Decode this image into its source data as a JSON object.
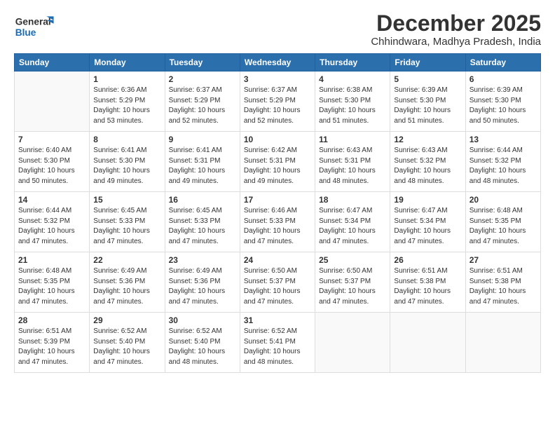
{
  "header": {
    "logo_general": "General",
    "logo_blue": "Blue",
    "month": "December 2025",
    "location": "Chhindwara, Madhya Pradesh, India"
  },
  "weekdays": [
    "Sunday",
    "Monday",
    "Tuesday",
    "Wednesday",
    "Thursday",
    "Friday",
    "Saturday"
  ],
  "weeks": [
    [
      {
        "day": "",
        "sunrise": "",
        "sunset": "",
        "daylight": ""
      },
      {
        "day": "1",
        "sunrise": "Sunrise: 6:36 AM",
        "sunset": "Sunset: 5:29 PM",
        "daylight": "Daylight: 10 hours and 53 minutes."
      },
      {
        "day": "2",
        "sunrise": "Sunrise: 6:37 AM",
        "sunset": "Sunset: 5:29 PM",
        "daylight": "Daylight: 10 hours and 52 minutes."
      },
      {
        "day": "3",
        "sunrise": "Sunrise: 6:37 AM",
        "sunset": "Sunset: 5:29 PM",
        "daylight": "Daylight: 10 hours and 52 minutes."
      },
      {
        "day": "4",
        "sunrise": "Sunrise: 6:38 AM",
        "sunset": "Sunset: 5:30 PM",
        "daylight": "Daylight: 10 hours and 51 minutes."
      },
      {
        "day": "5",
        "sunrise": "Sunrise: 6:39 AM",
        "sunset": "Sunset: 5:30 PM",
        "daylight": "Daylight: 10 hours and 51 minutes."
      },
      {
        "day": "6",
        "sunrise": "Sunrise: 6:39 AM",
        "sunset": "Sunset: 5:30 PM",
        "daylight": "Daylight: 10 hours and 50 minutes."
      }
    ],
    [
      {
        "day": "7",
        "sunrise": "Sunrise: 6:40 AM",
        "sunset": "Sunset: 5:30 PM",
        "daylight": "Daylight: 10 hours and 50 minutes."
      },
      {
        "day": "8",
        "sunrise": "Sunrise: 6:41 AM",
        "sunset": "Sunset: 5:30 PM",
        "daylight": "Daylight: 10 hours and 49 minutes."
      },
      {
        "day": "9",
        "sunrise": "Sunrise: 6:41 AM",
        "sunset": "Sunset: 5:31 PM",
        "daylight": "Daylight: 10 hours and 49 minutes."
      },
      {
        "day": "10",
        "sunrise": "Sunrise: 6:42 AM",
        "sunset": "Sunset: 5:31 PM",
        "daylight": "Daylight: 10 hours and 49 minutes."
      },
      {
        "day": "11",
        "sunrise": "Sunrise: 6:43 AM",
        "sunset": "Sunset: 5:31 PM",
        "daylight": "Daylight: 10 hours and 48 minutes."
      },
      {
        "day": "12",
        "sunrise": "Sunrise: 6:43 AM",
        "sunset": "Sunset: 5:32 PM",
        "daylight": "Daylight: 10 hours and 48 minutes."
      },
      {
        "day": "13",
        "sunrise": "Sunrise: 6:44 AM",
        "sunset": "Sunset: 5:32 PM",
        "daylight": "Daylight: 10 hours and 48 minutes."
      }
    ],
    [
      {
        "day": "14",
        "sunrise": "Sunrise: 6:44 AM",
        "sunset": "Sunset: 5:32 PM",
        "daylight": "Daylight: 10 hours and 47 minutes."
      },
      {
        "day": "15",
        "sunrise": "Sunrise: 6:45 AM",
        "sunset": "Sunset: 5:33 PM",
        "daylight": "Daylight: 10 hours and 47 minutes."
      },
      {
        "day": "16",
        "sunrise": "Sunrise: 6:45 AM",
        "sunset": "Sunset: 5:33 PM",
        "daylight": "Daylight: 10 hours and 47 minutes."
      },
      {
        "day": "17",
        "sunrise": "Sunrise: 6:46 AM",
        "sunset": "Sunset: 5:33 PM",
        "daylight": "Daylight: 10 hours and 47 minutes."
      },
      {
        "day": "18",
        "sunrise": "Sunrise: 6:47 AM",
        "sunset": "Sunset: 5:34 PM",
        "daylight": "Daylight: 10 hours and 47 minutes."
      },
      {
        "day": "19",
        "sunrise": "Sunrise: 6:47 AM",
        "sunset": "Sunset: 5:34 PM",
        "daylight": "Daylight: 10 hours and 47 minutes."
      },
      {
        "day": "20",
        "sunrise": "Sunrise: 6:48 AM",
        "sunset": "Sunset: 5:35 PM",
        "daylight": "Daylight: 10 hours and 47 minutes."
      }
    ],
    [
      {
        "day": "21",
        "sunrise": "Sunrise: 6:48 AM",
        "sunset": "Sunset: 5:35 PM",
        "daylight": "Daylight: 10 hours and 47 minutes."
      },
      {
        "day": "22",
        "sunrise": "Sunrise: 6:49 AM",
        "sunset": "Sunset: 5:36 PM",
        "daylight": "Daylight: 10 hours and 47 minutes."
      },
      {
        "day": "23",
        "sunrise": "Sunrise: 6:49 AM",
        "sunset": "Sunset: 5:36 PM",
        "daylight": "Daylight: 10 hours and 47 minutes."
      },
      {
        "day": "24",
        "sunrise": "Sunrise: 6:50 AM",
        "sunset": "Sunset: 5:37 PM",
        "daylight": "Daylight: 10 hours and 47 minutes."
      },
      {
        "day": "25",
        "sunrise": "Sunrise: 6:50 AM",
        "sunset": "Sunset: 5:37 PM",
        "daylight": "Daylight: 10 hours and 47 minutes."
      },
      {
        "day": "26",
        "sunrise": "Sunrise: 6:51 AM",
        "sunset": "Sunset: 5:38 PM",
        "daylight": "Daylight: 10 hours and 47 minutes."
      },
      {
        "day": "27",
        "sunrise": "Sunrise: 6:51 AM",
        "sunset": "Sunset: 5:38 PM",
        "daylight": "Daylight: 10 hours and 47 minutes."
      }
    ],
    [
      {
        "day": "28",
        "sunrise": "Sunrise: 6:51 AM",
        "sunset": "Sunset: 5:39 PM",
        "daylight": "Daylight: 10 hours and 47 minutes."
      },
      {
        "day": "29",
        "sunrise": "Sunrise: 6:52 AM",
        "sunset": "Sunset: 5:40 PM",
        "daylight": "Daylight: 10 hours and 47 minutes."
      },
      {
        "day": "30",
        "sunrise": "Sunrise: 6:52 AM",
        "sunset": "Sunset: 5:40 PM",
        "daylight": "Daylight: 10 hours and 48 minutes."
      },
      {
        "day": "31",
        "sunrise": "Sunrise: 6:52 AM",
        "sunset": "Sunset: 5:41 PM",
        "daylight": "Daylight: 10 hours and 48 minutes."
      },
      {
        "day": "",
        "sunrise": "",
        "sunset": "",
        "daylight": ""
      },
      {
        "day": "",
        "sunrise": "",
        "sunset": "",
        "daylight": ""
      },
      {
        "day": "",
        "sunrise": "",
        "sunset": "",
        "daylight": ""
      }
    ]
  ]
}
